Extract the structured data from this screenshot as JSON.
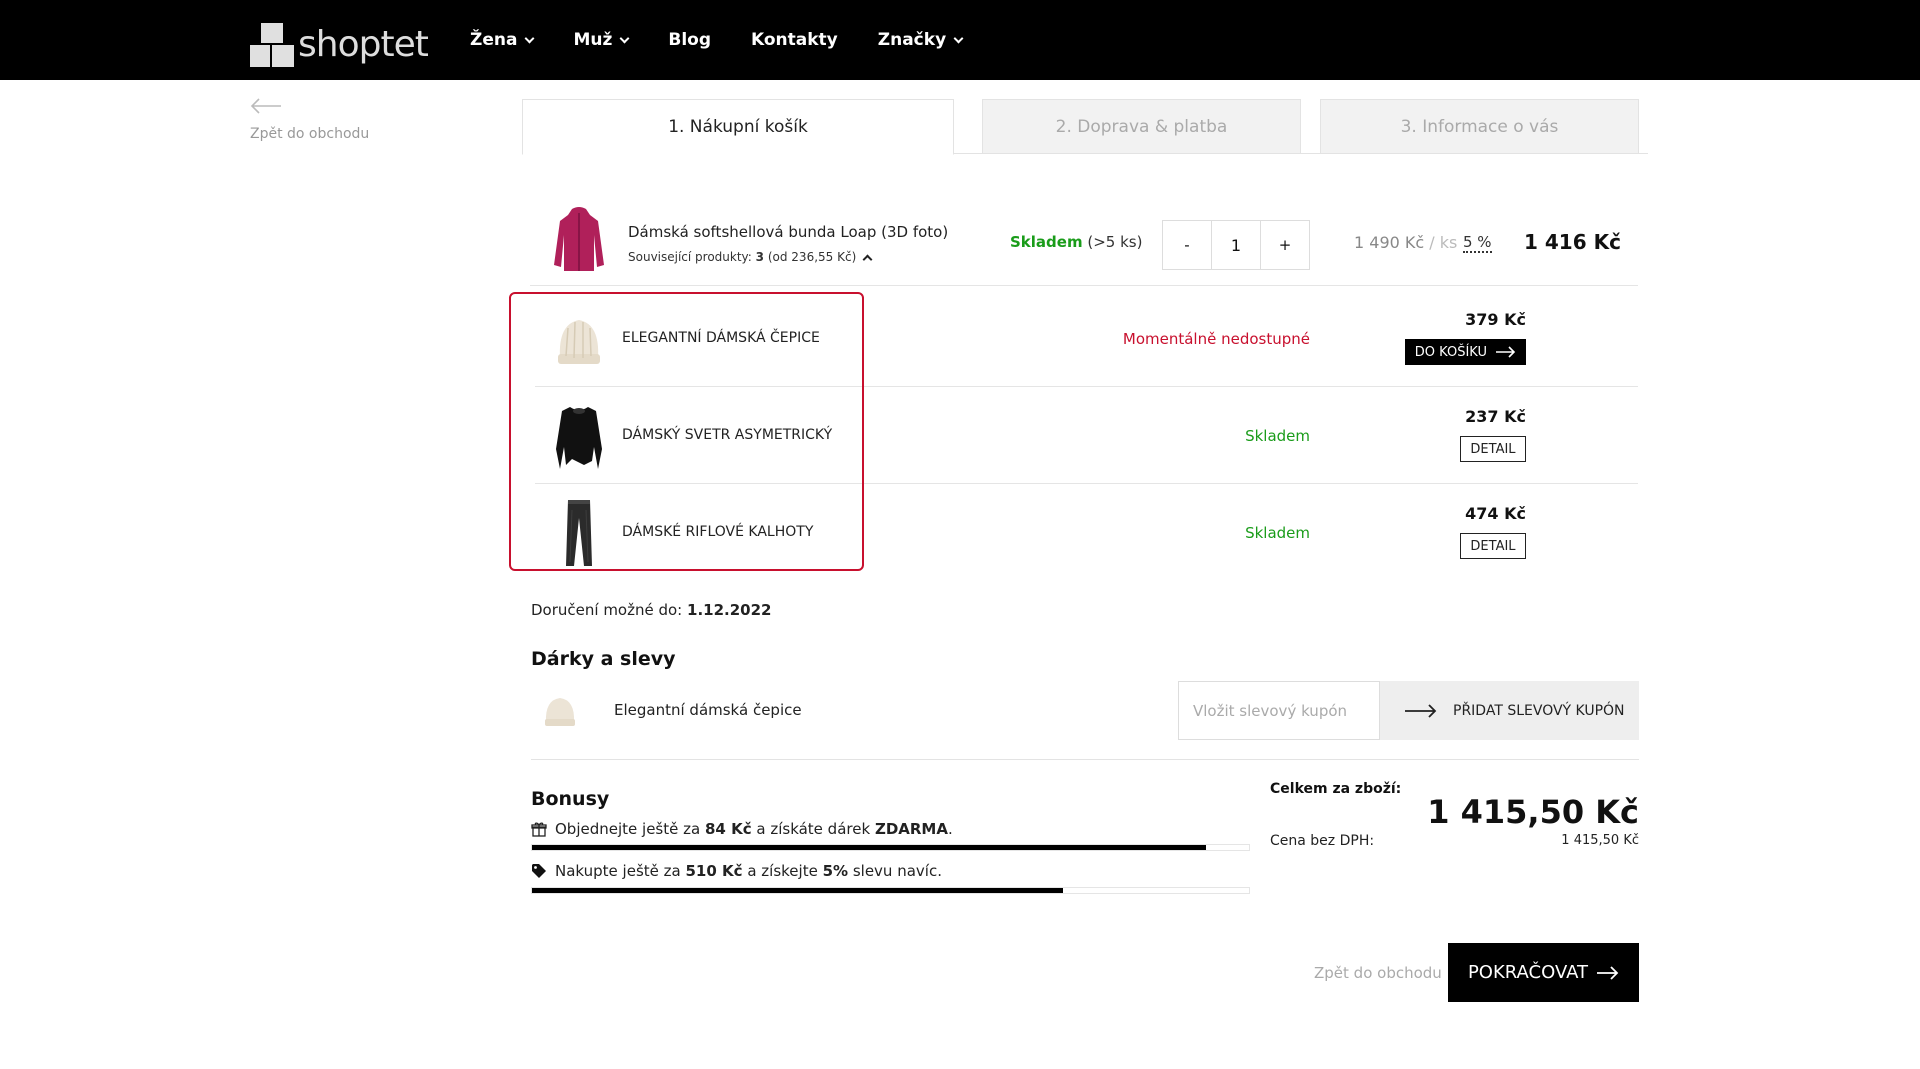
{
  "header": {
    "logo_text": "shoptet",
    "nav": [
      "Žena",
      "Muž",
      "Blog",
      "Kontakty",
      "Značky"
    ]
  },
  "back_link": "Zpět do obchodu",
  "steps": [
    "1. Nákupní košík",
    "2. Doprava & platba",
    "3. Informace o vás"
  ],
  "cart_item": {
    "name": "Dámská softshellová bunda Loap (3D foto)",
    "related_label": "Související produkty:",
    "related_count": "3",
    "related_from": "(od 236,55 Kč)",
    "stock_label": "Skladem",
    "stock_qty": "(>5 ks)",
    "qty_minus": "-",
    "qty_value": "1",
    "qty_plus": "+",
    "unit_price": "1 490 Kč",
    "unit_suffix": "/ ks",
    "discount": "5 %",
    "total": "1 416 Kč"
  },
  "related_products": [
    {
      "name": "ELEGANTNÍ DÁMSKÁ ČEPICE",
      "status": "Momentálně nedostupné",
      "price": "379 Kč",
      "button": "DO KOŠÍKU"
    },
    {
      "name": "DÁMSKÝ SVETR ASYMETRICKÝ",
      "status": "Skladem",
      "price": "237 Kč",
      "button": "DETAIL"
    },
    {
      "name": "DÁMSKÉ RIFLOVÉ KALHOTY",
      "status": "Skladem",
      "price": "474 Kč",
      "button": "DETAIL"
    }
  ],
  "delivery": {
    "label": "Doručení možné do:",
    "date": "1.12.2022"
  },
  "gifts": {
    "title": "Dárky a slevy",
    "gift_name": "Elegantní dámská čepice",
    "coupon_placeholder": "Vložit slevový kupón",
    "coupon_button": "PŘIDAT SLEVOVÝ KUPÓN"
  },
  "bonus": {
    "title": "Bonusy",
    "gift": {
      "pre": "Objednejte ještě za",
      "amount": "84 Kč",
      "mid": "a získáte dárek",
      "end": "ZDARMA",
      "dot": ".",
      "progress": 0.94
    },
    "discount": {
      "pre": "Nakupte ještě za",
      "amount": "510 Kč",
      "mid": "a získejte",
      "pct": "5%",
      "end": "slevu navíc.",
      "progress": 0.74
    }
  },
  "totals": {
    "label": "Celkem za zboží:",
    "value": "1 415,50 Kč",
    "vat_label": "Cena bez DPH:",
    "vat_value": "1 415,50 Kč"
  },
  "footer": {
    "back": "Zpět do obchodu",
    "continue": "POKRAČOVAT"
  },
  "colors": {
    "accent_red": "#c8102e",
    "stock_green": "#1a9c1a",
    "black": "#000000"
  }
}
